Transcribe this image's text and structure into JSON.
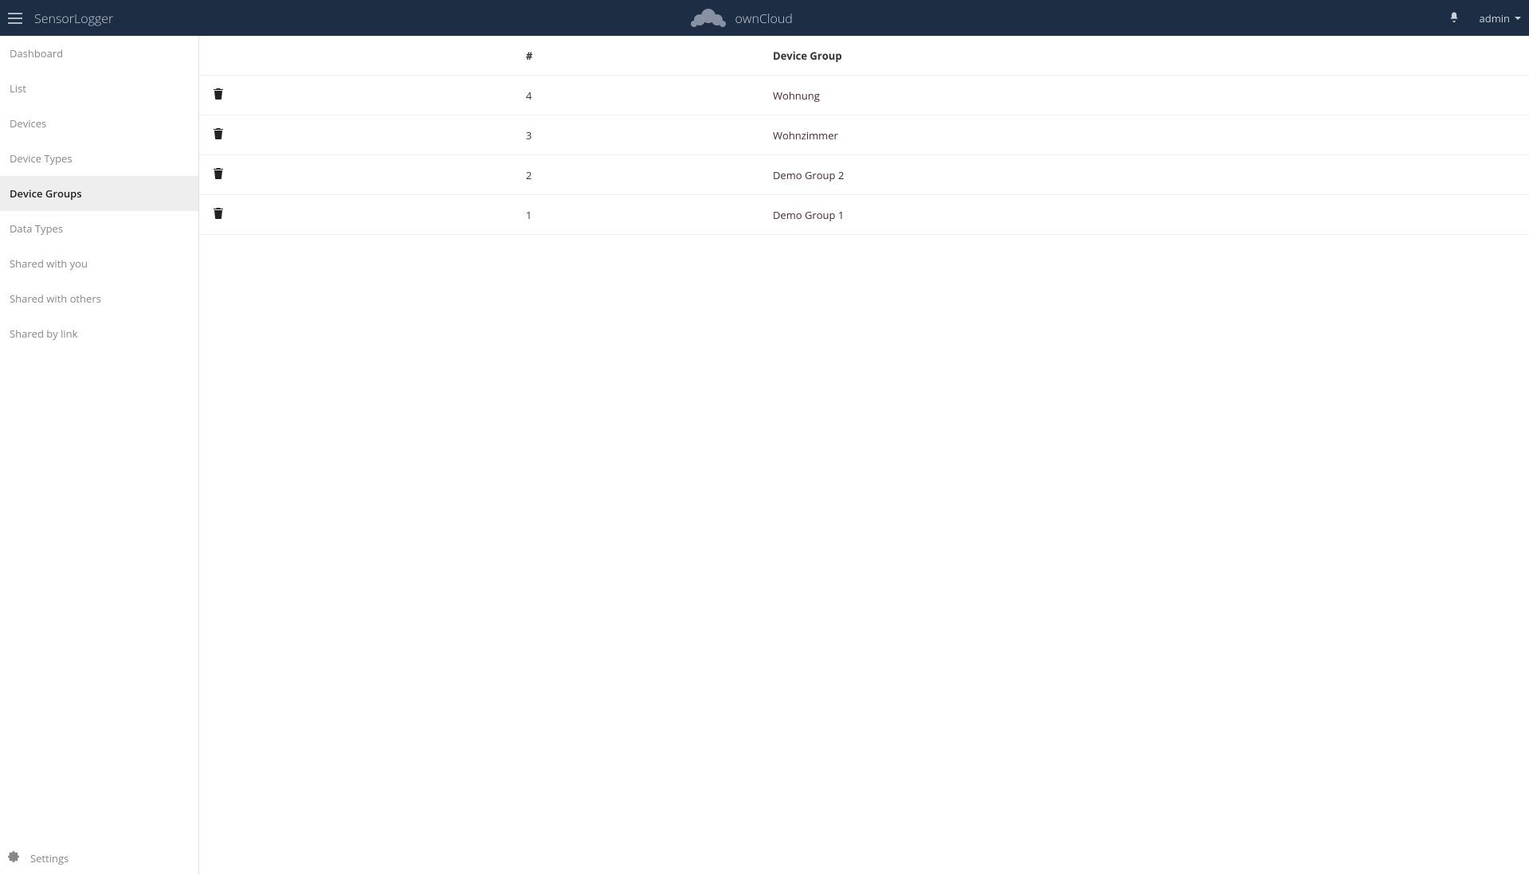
{
  "topbar": {
    "app_name": "SensorLogger",
    "brand": "ownCloud",
    "user": "admin"
  },
  "sidebar": {
    "items": [
      {
        "label": "Dashboard",
        "active": false
      },
      {
        "label": "List",
        "active": false
      },
      {
        "label": "Devices",
        "active": false
      },
      {
        "label": "Device Types",
        "active": false
      },
      {
        "label": "Device Groups",
        "active": true
      },
      {
        "label": "Data Types",
        "active": false
      },
      {
        "label": "Shared with you",
        "active": false
      },
      {
        "label": "Shared with others",
        "active": false
      },
      {
        "label": "Shared by link",
        "active": false
      }
    ],
    "settings_label": "Settings"
  },
  "table": {
    "headers": {
      "id": "#",
      "name": "Device Group"
    },
    "rows": [
      {
        "id": "4",
        "name": "Wohnung"
      },
      {
        "id": "3",
        "name": "Wohnzimmer"
      },
      {
        "id": "2",
        "name": "Demo Group 2"
      },
      {
        "id": "1",
        "name": "Demo Group 1"
      }
    ]
  }
}
